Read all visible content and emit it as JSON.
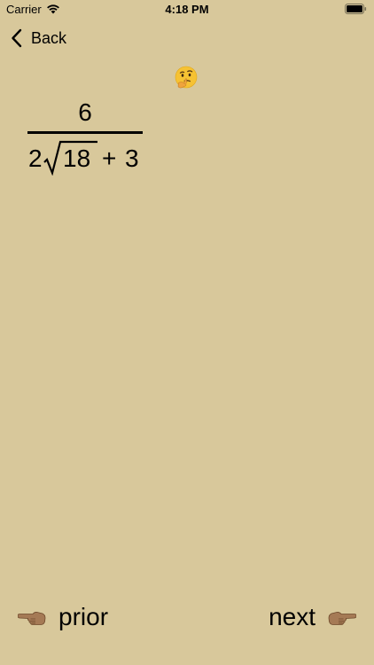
{
  "status_bar": {
    "carrier": "Carrier",
    "time": "4:18 PM",
    "icons": [
      "wifi-icon",
      "battery-icon"
    ]
  },
  "nav": {
    "back_label": "Back",
    "back_icon": "chevron-left-icon"
  },
  "hint_icon": "thinking-face-icon",
  "fraction": {
    "numerator": "6",
    "denominator": {
      "coefficient": "2",
      "radicand": "18",
      "operator": "+",
      "constant": "3"
    }
  },
  "bottom_nav": {
    "prior_label": "prior",
    "prior_icon": "pointing-left-hand-icon",
    "next_label": "next",
    "next_icon": "pointing-right-hand-icon"
  },
  "colors": {
    "background": "#d8c89b",
    "text": "#000000",
    "hand": "#a57a55"
  }
}
